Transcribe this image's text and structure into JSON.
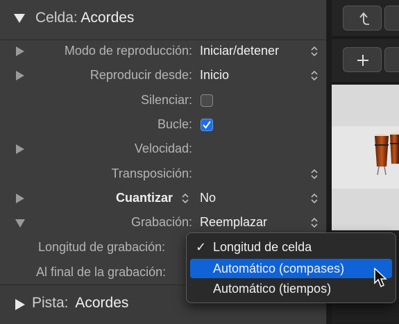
{
  "inspector": {
    "header": {
      "label": "Celda:",
      "name": "Acordes"
    },
    "rows": {
      "modo": {
        "label": "Modo de reproducción:",
        "value": "Iniciar/detener"
      },
      "reproducir": {
        "label": "Reproducir desde:",
        "value": "Inicio"
      },
      "silenciar": {
        "label": "Silenciar:",
        "checked": false
      },
      "bucle": {
        "label": "Bucle:",
        "checked": true
      },
      "velocidad": {
        "label": "Velocidad:"
      },
      "transposicion": {
        "label": "Transposición:"
      },
      "cuantizar": {
        "label": "Cuantizar",
        "value": "No"
      },
      "grabacion": {
        "label": "Grabación:",
        "value": "Reemplazar"
      },
      "longitud": {
        "label": "Longitud de grabación:"
      },
      "alfinal": {
        "label": "Al final de la grabación:"
      }
    },
    "pista": {
      "label": "Pista:",
      "name": "Acordes"
    }
  },
  "popup_menu": {
    "items": [
      {
        "label": "Longitud de celda",
        "checked": true,
        "highlighted": false
      },
      {
        "label": "Automático (compases)",
        "checked": false,
        "highlighted": true
      },
      {
        "label": "Automático (tiempos)",
        "checked": false,
        "highlighted": false
      }
    ]
  },
  "toolbar": {
    "top_icon": "return-arrow-icon",
    "add_icon": "plus-icon"
  },
  "colors": {
    "accent": "#1b6fe6",
    "menu_highlight": "#0f63d6"
  }
}
